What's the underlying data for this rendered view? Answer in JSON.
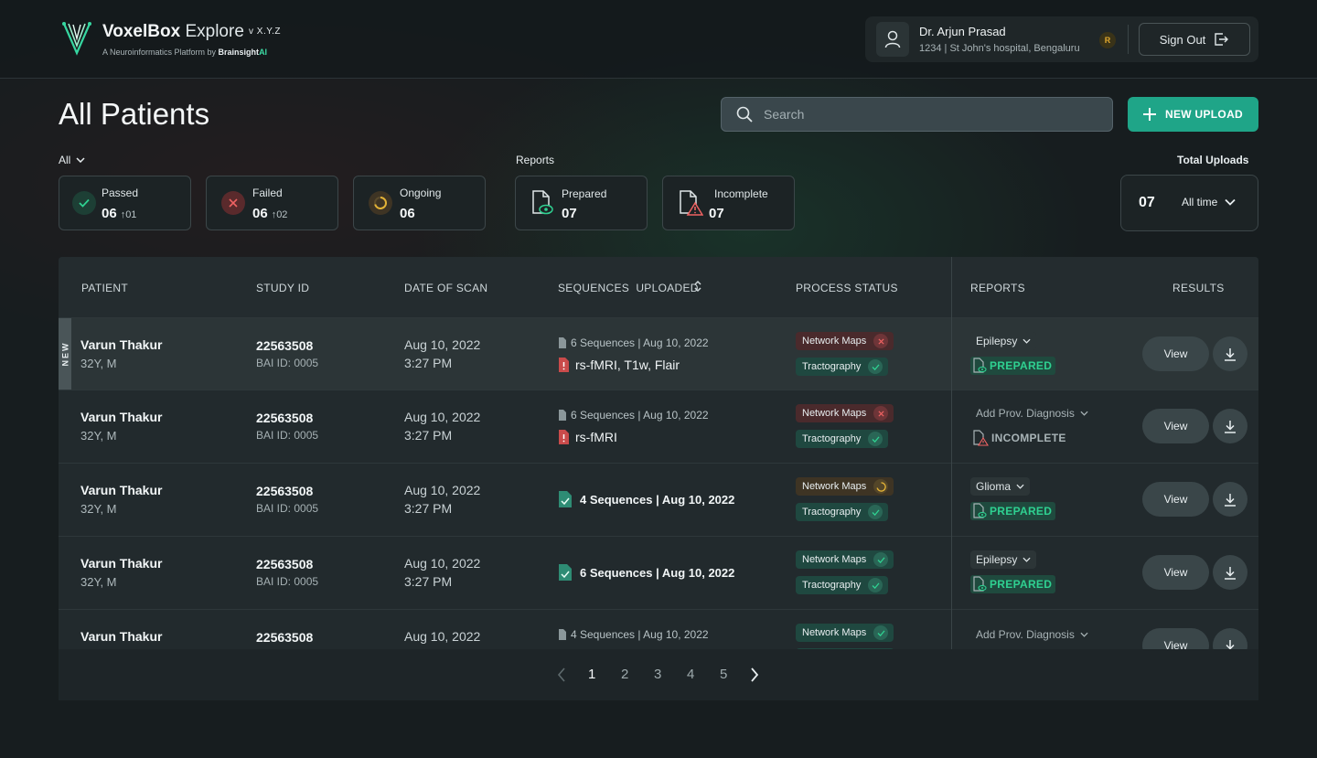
{
  "app": {
    "name_bold": "VoxelBox",
    "name_light": " Explore",
    "version": "v X.Y.Z",
    "tagline_prefix": "A Neuroinformatics Platform by ",
    "tagline_brand": "Brainsight",
    "tagline_ai": "AI",
    "accent": "#1fa588"
  },
  "user": {
    "name": "Dr. Arjun Prasad",
    "hospital": "1234 | St John's hospital, Bengaluru",
    "badge": "R",
    "signout_label": "Sign Out"
  },
  "page": {
    "title": "All Patients",
    "search_placeholder": "Search",
    "new_upload_label": "NEW UPLOAD"
  },
  "filters": {
    "all_label": "All",
    "reports_label": "Reports",
    "total_uploads_label": "Total Uploads"
  },
  "stats": {
    "passed": {
      "label": "Passed",
      "value": "06",
      "delta": "01"
    },
    "failed": {
      "label": "Failed",
      "value": "06",
      "delta": "02"
    },
    "ongoing": {
      "label": "Ongoing",
      "value": "06"
    },
    "prepared": {
      "label": "Prepared",
      "value": "07"
    },
    "incomplete": {
      "label": "Incomplete",
      "value": "07"
    },
    "total": {
      "value": "07",
      "range": "All time"
    }
  },
  "table": {
    "headers": {
      "patient": "PATIENT",
      "study": "STUDY ID",
      "date": "DATE OF SCAN",
      "sequences": "SEQUENCES  UPLOADED",
      "process": "PROCESS STATUS",
      "reports": "REPORTS",
      "results": "RESULTS"
    },
    "new_tag": "NEW",
    "view_label": "View",
    "rows": [
      {
        "name": "Varun Thakur",
        "meta": "32Y, M",
        "study": "22563508",
        "bai": "BAI ID: 0005",
        "date": "Aug 10, 2022",
        "time": "3:27 PM",
        "seq_summary": "6 Sequences | Aug 10, 2022",
        "seq_names": "rs-fMRI, T1w, Flair",
        "p1": "Network Maps",
        "p2": "Tractography",
        "report": "Epilepsy",
        "status": "PREPARED"
      },
      {
        "name": "Varun Thakur",
        "meta": "32Y, M",
        "study": "22563508",
        "bai": "BAI ID: 0005",
        "date": "Aug 10, 2022",
        "time": "3:27 PM",
        "seq_summary": "6 Sequences | Aug 10, 2022",
        "seq_names": "rs-fMRI",
        "p1": "Network Maps",
        "p2": "Tractography",
        "report": "Add Prov. Diagnosis",
        "status": "INCOMPLETE"
      },
      {
        "name": "Varun Thakur",
        "meta": "32Y, M",
        "study": "22563508",
        "bai": "BAI ID: 0005",
        "date": "Aug 10, 2022",
        "time": "3:27 PM",
        "seq_count": "4 Sequences",
        "seq_date": "Aug 10, 2022",
        "p1": "Network Maps",
        "p2": "Tractography",
        "report": "Glioma",
        "status": "PREPARED"
      },
      {
        "name": "Varun Thakur",
        "meta": "32Y, M",
        "study": "22563508",
        "bai": "BAI ID: 0005",
        "date": "Aug 10, 2022",
        "time": "3:27 PM",
        "seq_count": "6 Sequences",
        "seq_date": "Aug 10, 2022",
        "p1": "Network Maps",
        "p2": "Tractography",
        "report": "Epilepsy",
        "status": "PREPARED"
      },
      {
        "name": "Varun Thakur",
        "study": "22563508",
        "date": "Aug 10, 2022",
        "seq_summary": "4 Sequences | Aug 10, 2022",
        "p1": "Network Maps",
        "report": "Add Prov. Diagnosis"
      }
    ]
  },
  "pagination": {
    "pages": [
      "1",
      "2",
      "3",
      "4",
      "5"
    ],
    "current": "1"
  }
}
